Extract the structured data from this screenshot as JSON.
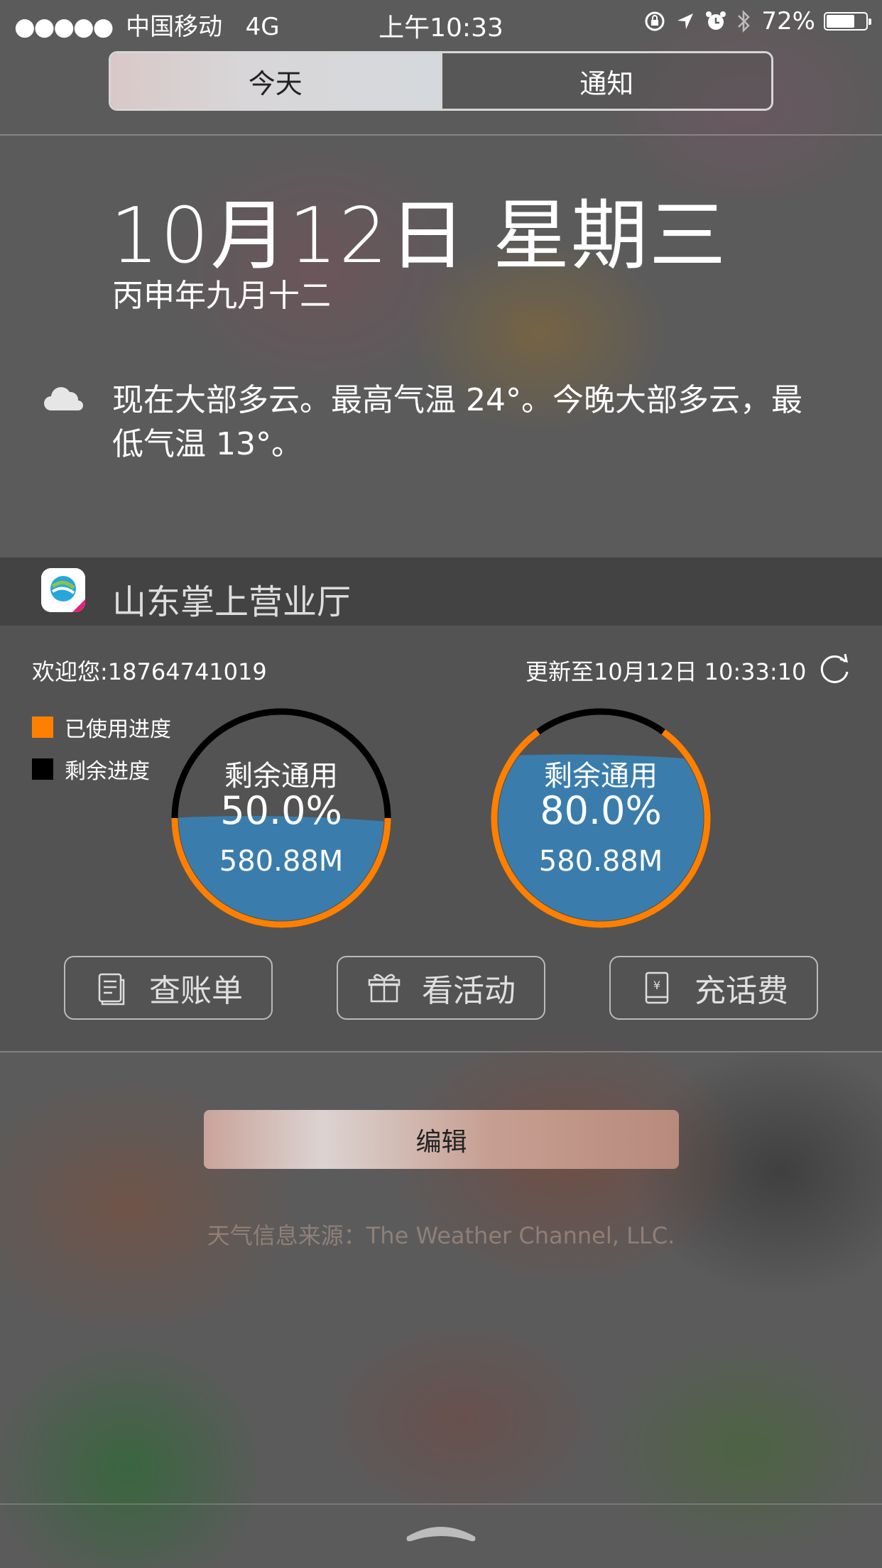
{
  "status_bar": {
    "signal_dots": "●●●●●",
    "carrier": "中国移动",
    "network": "4G",
    "time": "上午10:33",
    "battery_percent": "72%",
    "battery_level": 0.72,
    "icons": [
      "rotation-lock-icon",
      "location-arrow-icon",
      "alarm-icon",
      "bluetooth-icon",
      "battery-icon"
    ]
  },
  "segmented": {
    "today_label": "今天",
    "notifications_label": "通知",
    "selected": "今天"
  },
  "today": {
    "date": "10月12日 星期三",
    "lunar_date": "丙申年九月十二",
    "weather_text": "现在大部多云。最高气温 24°。今晚大部多云，最低气温 13°。",
    "weather_icon": "cloud-icon"
  },
  "widget": {
    "title": "山东掌上营业厅",
    "welcome": "欢迎您:18764741019",
    "updated": "更新至10月12日 10:33:10",
    "legend": [
      {
        "label": "已使用进度",
        "color": "#ff8000"
      },
      {
        "label": "剩余进度",
        "color": "#000000"
      }
    ],
    "gauges": [
      {
        "label": "剩余通用",
        "percent_text": "50.0%",
        "amount": "580.88M",
        "fill": 0.5,
        "used_arc": 0.5
      },
      {
        "label": "剩余通用",
        "percent_text": "80.0%",
        "amount": "580.88M",
        "fill": 0.8,
        "used_arc": 0.8
      }
    ],
    "actions": [
      {
        "label": "查账单",
        "icon": "bill-icon"
      },
      {
        "label": "看活动",
        "icon": "gift-icon"
      },
      {
        "label": "充话费",
        "icon": "recharge-icon"
      }
    ],
    "colors": {
      "water": "#3a7dac",
      "used": "#ff8000",
      "remaining": "#000000"
    }
  },
  "edit_button": "编辑",
  "weather_source": "天气信息来源：The Weather Channel, LLC."
}
